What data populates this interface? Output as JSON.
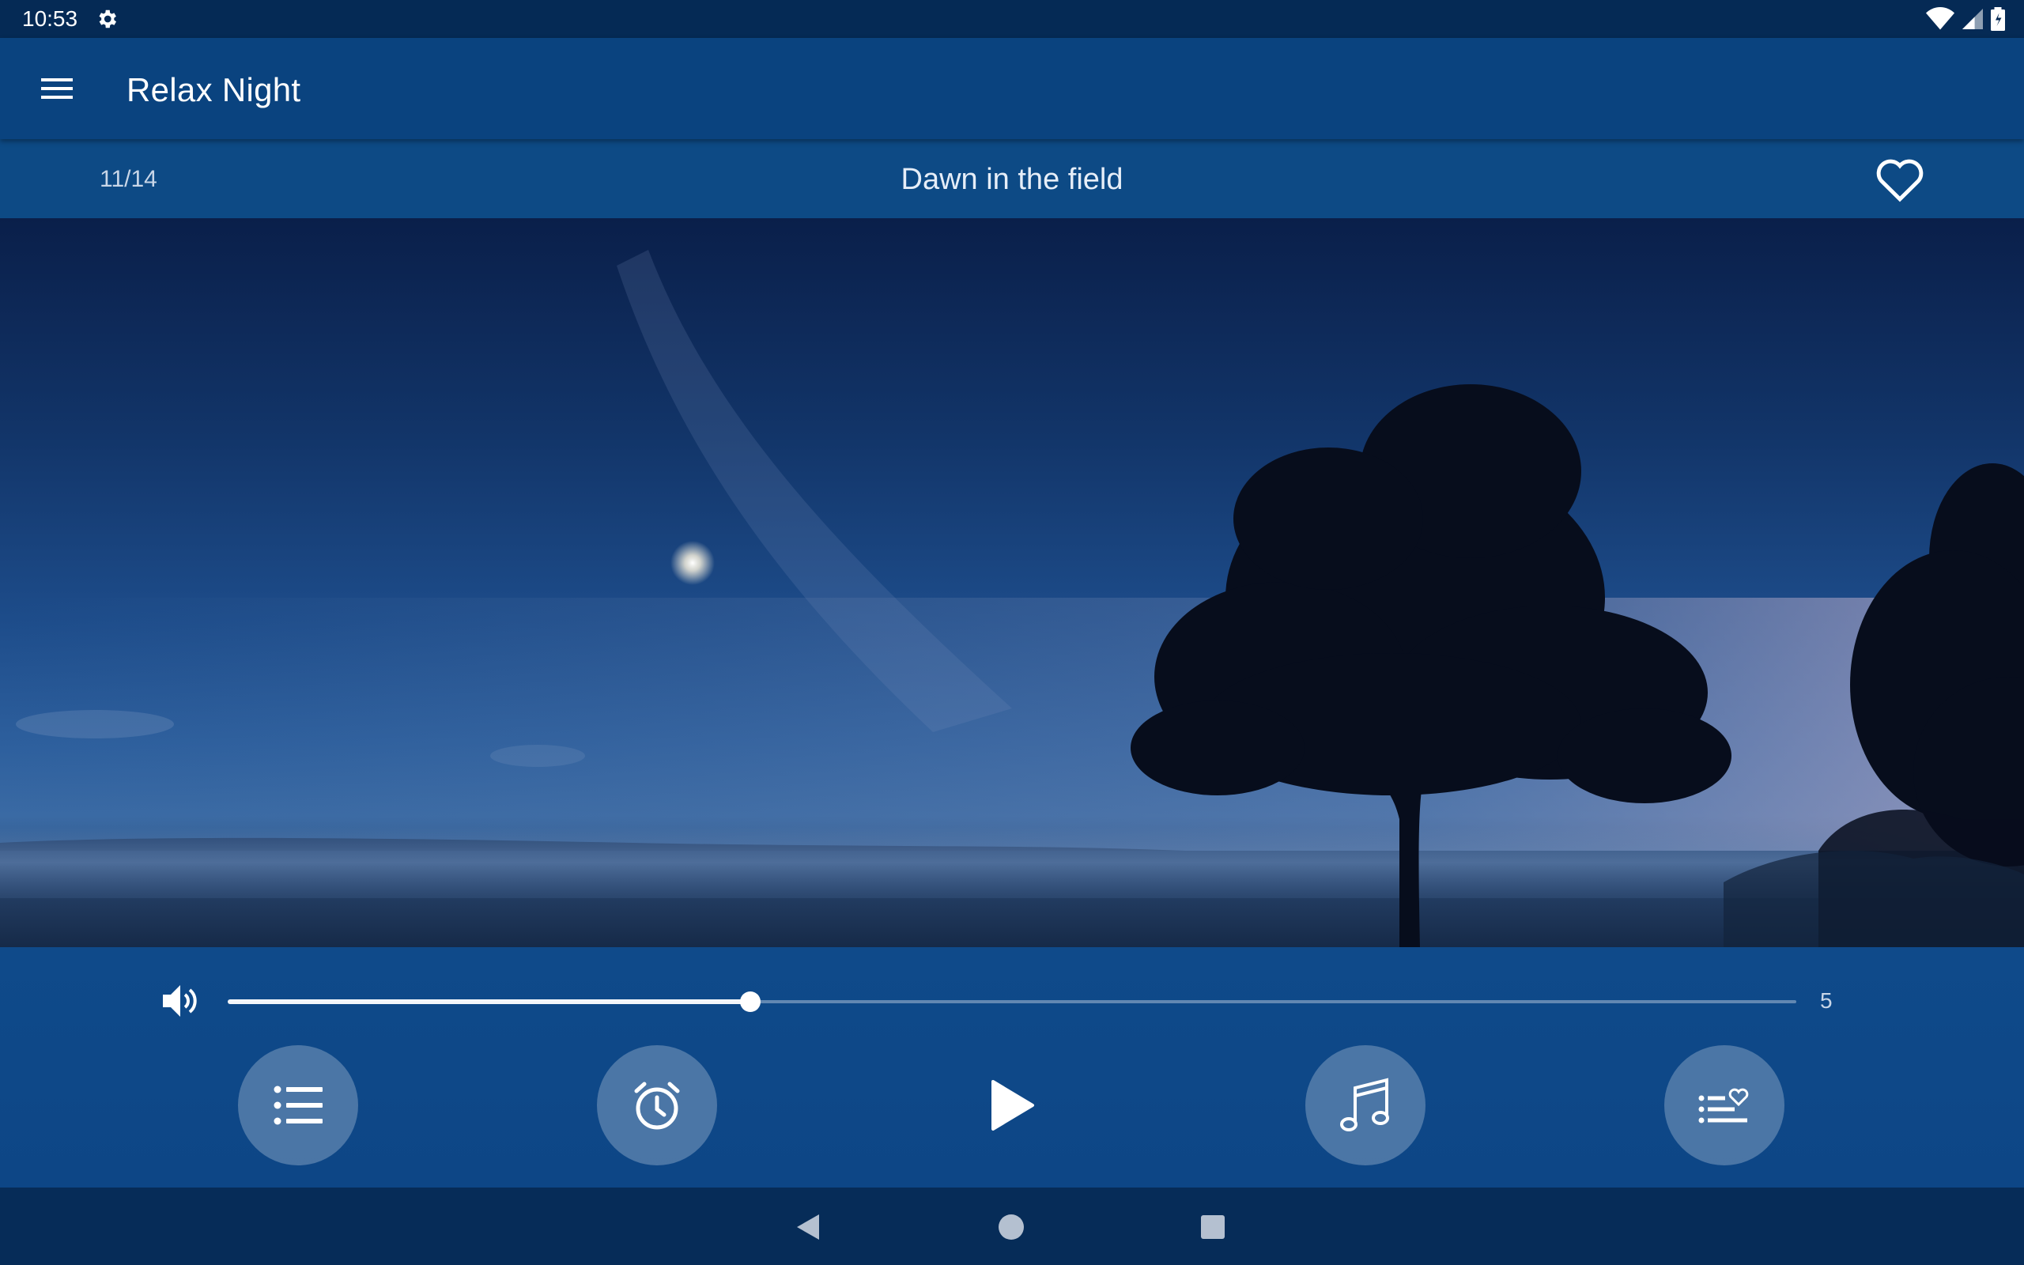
{
  "status_bar": {
    "time": "10:53",
    "icons": [
      "gear-icon",
      "wifi-icon",
      "signal-icon",
      "battery-icon"
    ]
  },
  "app_bar": {
    "title": "Relax Night",
    "menu_icon": "hamburger-menu-icon"
  },
  "track": {
    "count": "11/14",
    "title": "Dawn in the field",
    "favorite_icon": "heart-outline-icon"
  },
  "player": {
    "volume_icon": "speaker-icon",
    "volume_fraction": 0.333,
    "volume_value": "5",
    "buttons": [
      {
        "name": "playlist-button",
        "icon": "list-icon"
      },
      {
        "name": "timer-button",
        "icon": "alarm-clock-icon"
      },
      {
        "name": "play-button",
        "icon": "play-icon"
      },
      {
        "name": "music-button",
        "icon": "music-note-icon"
      },
      {
        "name": "favorites-list-button",
        "icon": "favorites-list-icon"
      }
    ]
  },
  "nav_bar": {
    "icons": [
      "back-triangle-icon",
      "home-circle-icon",
      "recents-square-icon"
    ]
  },
  "colors": {
    "status_bar": "#052a55",
    "app_bar": "#0a437f",
    "track_bar": "#0d4a85",
    "controls": "#0f4a8a",
    "nav_bar": "#062c58"
  }
}
